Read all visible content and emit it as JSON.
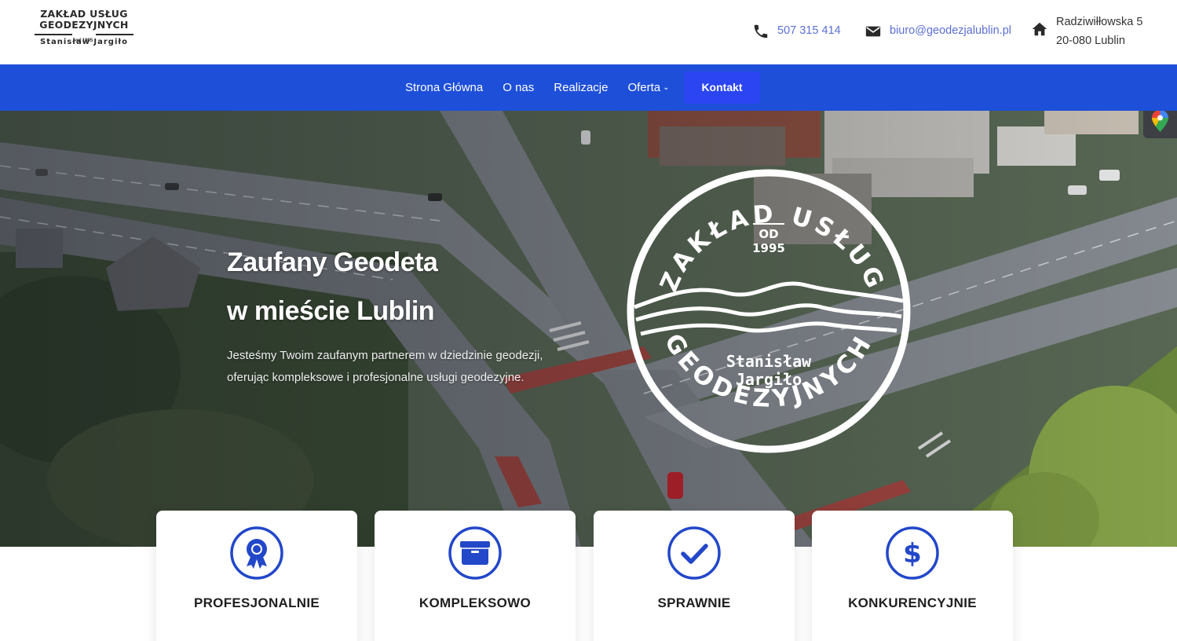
{
  "logo": {
    "line1": "ZAKŁAD USŁUG",
    "line2": "GEODEZYJNYCH",
    "since": "od 1995",
    "owner": "Stanisław Jargiło"
  },
  "contact": {
    "phone_icon": "phone-icon",
    "phone": "507 315 414",
    "email_icon": "envelope-icon",
    "email": "biuro@geodezjalublin.pl",
    "address_icon": "home-icon",
    "address_line1": "Radziwiłłowska 5",
    "address_line2": "20-080 Lublin",
    "link_color": "#5a6fd6"
  },
  "nav": {
    "background": "#1e4fd8",
    "items": [
      {
        "label": "Strona Główna"
      },
      {
        "label": "O nas"
      },
      {
        "label": "Realizacje"
      },
      {
        "label": "Oferta",
        "has_dropdown": true
      }
    ],
    "cta_label": "Kontakt",
    "cta_color": "#2b45f2"
  },
  "hero": {
    "title_line1": "Zaufany Geodeta",
    "title_line2": "w mieście Lublin",
    "text_line1": "Jesteśmy Twoim zaufanym partnerem w dziedzinie geodezji,",
    "text_line2": "oferując kompleksowe i profesjonalne usługi geodezyjne.",
    "badge": {
      "top_text": "ZAKŁAD USŁUG",
      "bottom_text": "GEODEZYJNYCH",
      "od": "OD",
      "year": "1995",
      "name1": "Stanisław",
      "name2": "Jargiło"
    },
    "map_widget_icon": "map-pin-icon"
  },
  "features": [
    {
      "label": "PROFESJONALNIE",
      "icon": "award-badge-icon"
    },
    {
      "label": "KOMPLEKSOWO",
      "icon": "box-icon"
    },
    {
      "label": "SPRAWNIE",
      "icon": "checkmark-icon"
    },
    {
      "label": "KONKURENCYJNIE",
      "icon": "dollar-icon"
    }
  ],
  "accent_color": "#1e4fd8"
}
